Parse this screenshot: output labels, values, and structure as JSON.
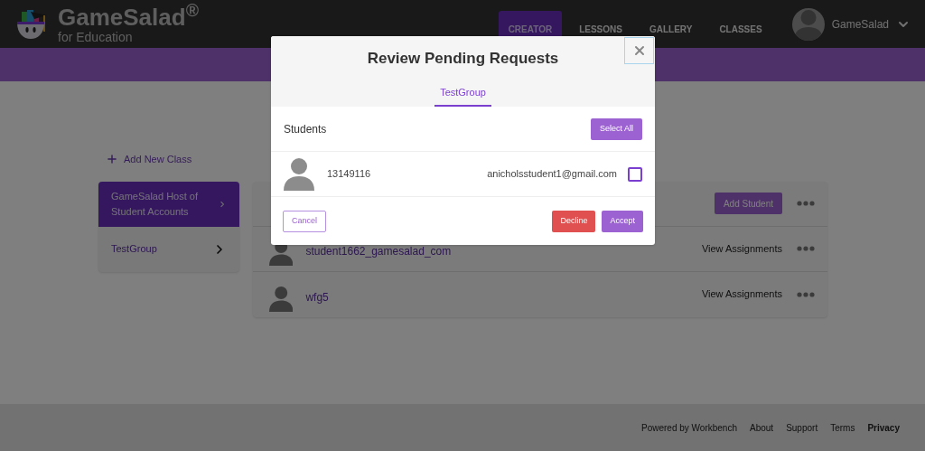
{
  "header": {
    "logo": {
      "name": "GameSalad$^{®}$",
      "subtitle": "for Education"
    },
    "nav": [
      {
        "label": "CREATOR",
        "selected": true
      },
      {
        "label": "LESSONS",
        "selected": false
      },
      {
        "label": "GALLERY",
        "selected": false
      },
      {
        "label": "CLASSES",
        "selected": false
      }
    ],
    "user": {
      "name": "GameSalad"
    }
  },
  "add_class": "Add New Class",
  "classes": [
    {
      "label": "GameSalad Host of Student Accounts",
      "selected": true
    },
    {
      "label": "TestGroup",
      "selected": false
    }
  ],
  "class_panel": {
    "add_button": "Add Student",
    "students": [
      {
        "name": "student1662_gamesalad_com",
        "action": "View Assignments"
      },
      {
        "name": "wfg5",
        "action": "View Assignments"
      }
    ]
  },
  "footer": {
    "powered": "Powered by Workbench",
    "links": [
      {
        "label": "About",
        "bold": false
      },
      {
        "label": "Support",
        "bold": false
      },
      {
        "label": "Terms",
        "bold": false
      },
      {
        "label": "Privacy",
        "bold": true
      }
    ]
  },
  "modal": {
    "title": "Review Pending Requests",
    "tabs": [
      {
        "label": "TestGroup",
        "selected": true
      }
    ],
    "section": "Students",
    "select_all": "Select All",
    "requests": [
      {
        "id": "13149116",
        "email": "anicholsstudent1@gmail.com",
        "checked": false
      }
    ],
    "cancel": "Cancel",
    "decline": "Decline",
    "accept": "Accept"
  }
}
